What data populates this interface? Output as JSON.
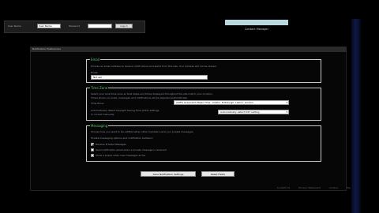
{
  "login_bar": {
    "username_label": "User Name",
    "username_value": "User Name",
    "password_label": "Password",
    "password_value": "",
    "login_button": "Log in"
  },
  "top_link": {
    "label": "Contact Manager"
  },
  "panel": {
    "header": "Notification Preferences"
  },
  "section1": {
    "legend": "Email",
    "description": "Provide an email address to receive notifications and alerts from this site. Your address will not be shared.",
    "email_label": "Email:",
    "email_value": "Not set"
  },
  "section2": {
    "legend": "Time Zone",
    "description": "Select your local time zone so that dates and times displayed throughout the site match your location.",
    "description2": "Times shown on posts, messages and notifications will be adjusted automatically.",
    "timezone_label": "Time Zone:",
    "timezone_value": "(GMT) Greenwich Mean Time : Dublin, Edinburgh, Lisbon, London",
    "dst_text": "Automatically detect Daylight Saving Time (DST) settings",
    "dst_text2": "or correct manually:",
    "dst_value": "Automatically detect DST setting"
  },
  "section3": {
    "legend": "Messaging",
    "description": "Choose how you want to be notified when other members send you private messages.",
    "sub_description": "Private messaging options and notification behavior:",
    "options": [
      {
        "label": "Receive Private Messages",
        "checked": true
      },
      {
        "label": "Send notification email when a private message is received",
        "checked": false
      },
      {
        "label": "Show a popup when new messages arrive",
        "checked": false
      }
    ]
  },
  "buttons": {
    "save": "Save Notification Settings",
    "reset": "Reset Fields"
  },
  "footer": {
    "links": [
      "Contact Us",
      "Privacy Statement",
      "Archive",
      "Top"
    ]
  }
}
